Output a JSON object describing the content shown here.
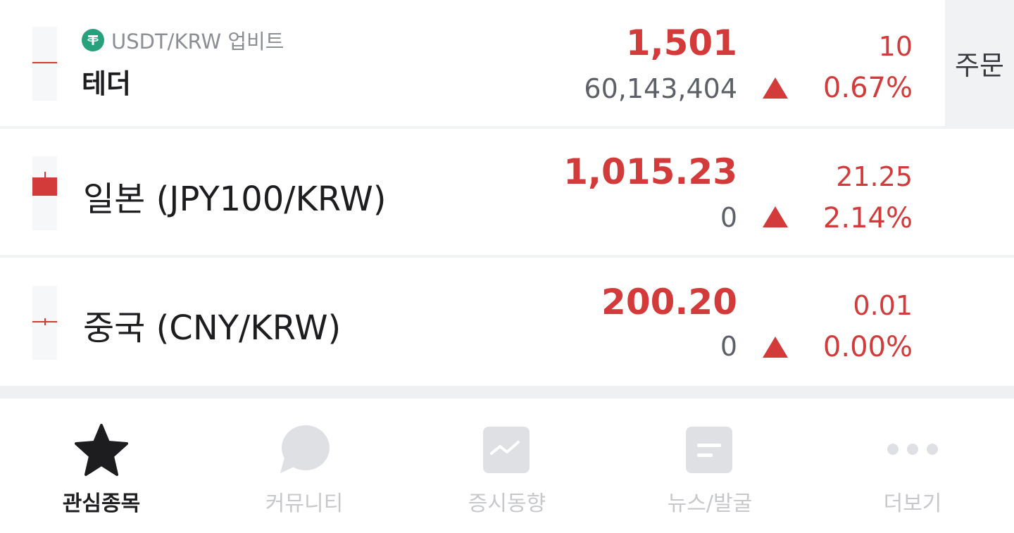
{
  "rows": [
    {
      "sub_label": "USDT/KRW 업비트",
      "coin_icon": "tether-icon",
      "name": "테더",
      "price": "1,501",
      "volume": "60,143,404",
      "change": "10",
      "rate": "0.67%",
      "direction": "up",
      "action_label": "주문"
    },
    {
      "name": "일본 (JPY100/KRW)",
      "price": "1,015.23",
      "volume": "0",
      "change": "21.25",
      "rate": "2.14%",
      "direction": "up"
    },
    {
      "name": "중국 (CNY/KRW)",
      "price": "200.20",
      "volume": "0",
      "change": "0.01",
      "rate": "0.00%",
      "direction": "up"
    }
  ],
  "colors": {
    "up": "#d33a3a",
    "tether": "#26a17b",
    "muted": "#c6c8cc",
    "active": "#1d1d20"
  },
  "tabs": [
    {
      "label": "관심종목",
      "icon": "star-icon",
      "active": true
    },
    {
      "label": "커뮤니티",
      "icon": "chat-bubble-icon",
      "active": false
    },
    {
      "label": "증시동향",
      "icon": "trend-chart-icon",
      "active": false
    },
    {
      "label": "뉴스/발굴",
      "icon": "news-icon",
      "active": false
    },
    {
      "label": "더보기",
      "icon": "more-dots-icon",
      "active": false
    }
  ]
}
